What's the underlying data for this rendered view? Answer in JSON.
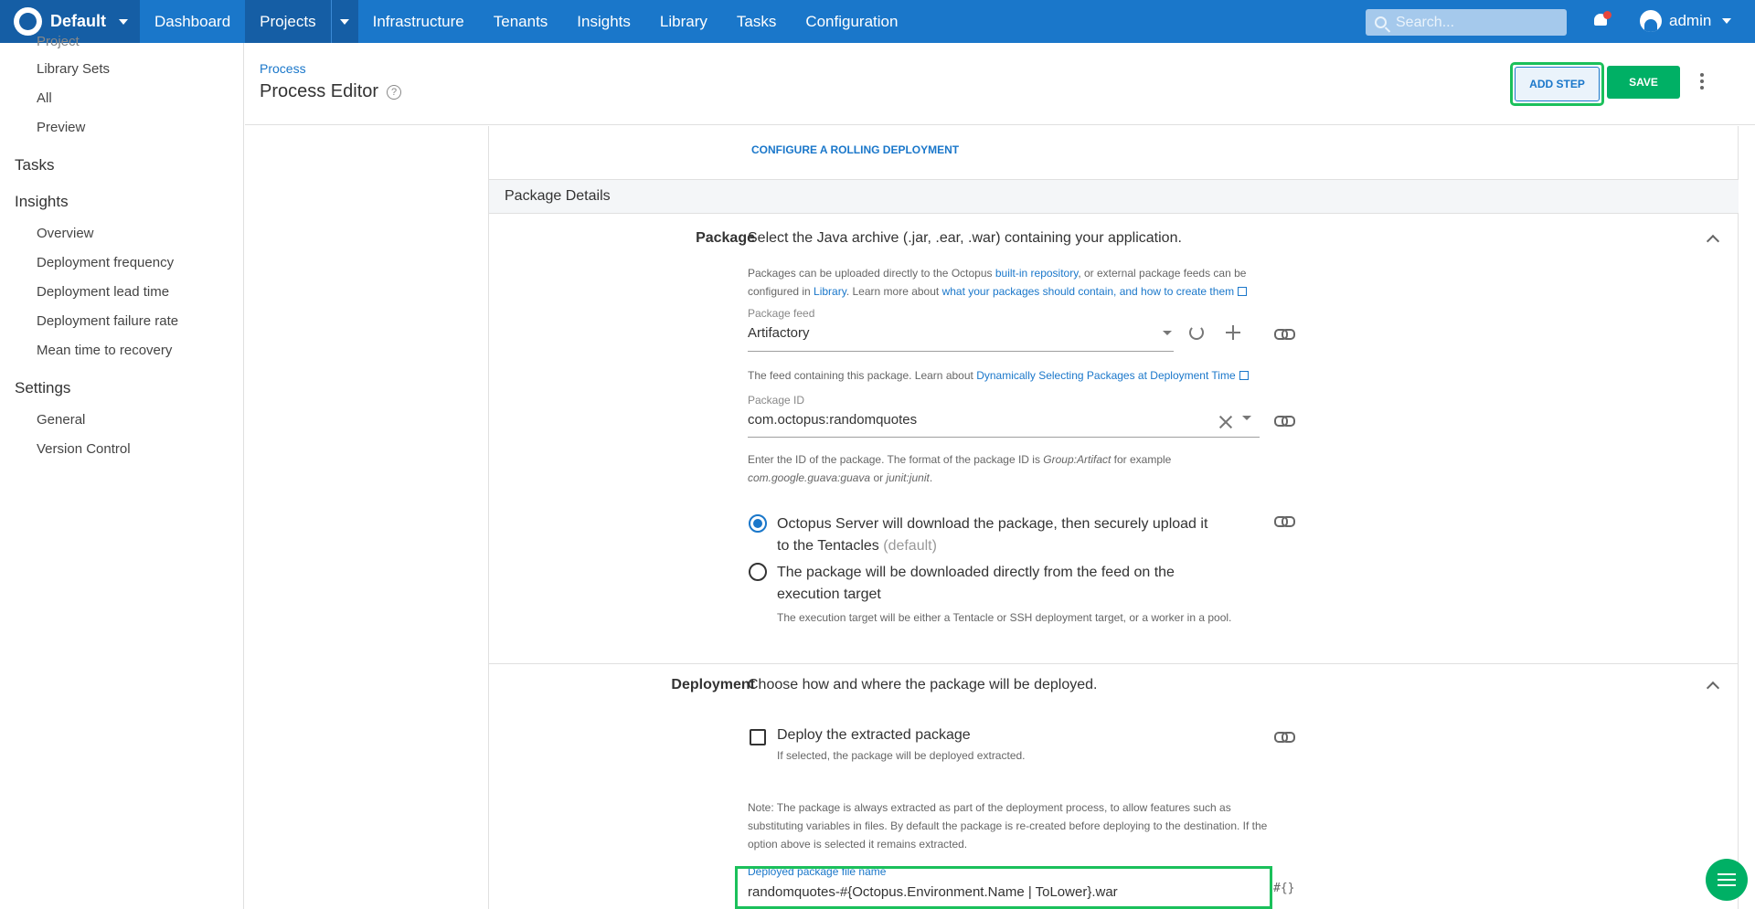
{
  "nav": {
    "space_name": "Default",
    "items": [
      "Dashboard",
      "Projects",
      "Infrastructure",
      "Tenants",
      "Insights",
      "Library",
      "Tasks",
      "Configuration"
    ],
    "search_placeholder": "Search...",
    "user": "admin"
  },
  "sidebar": {
    "cut_item": "Project",
    "library_sets": "Library Sets",
    "all": "All",
    "preview": "Preview",
    "tasks": "Tasks",
    "insights": "Insights",
    "insights_items": [
      "Overview",
      "Deployment frequency",
      "Deployment lead time",
      "Deployment failure rate",
      "Mean time to recovery"
    ],
    "settings": "Settings",
    "settings_items": [
      "General",
      "Version Control"
    ]
  },
  "header": {
    "breadcrumb": "Process",
    "title": "Process Editor",
    "help_glyph": "?",
    "add_step": "ADD STEP",
    "save": "SAVE"
  },
  "content": {
    "rolling_link": "CONFIGURE A ROLLING DEPLOYMENT",
    "section_title": "Package Details",
    "package": {
      "label": "Package",
      "summary": "Select the Java archive (.jar, .ear, .war) containing your application.",
      "help_1a": "Packages can be uploaded directly to the Octopus ",
      "help_1_link1": "built-in repository",
      "help_1b": ", or external package feeds can be",
      "help_2a": "configured in ",
      "help_2_link2": "Library",
      "help_2b": ". Learn more about ",
      "help_2_link3": "what your packages should contain, and how to create them",
      "feed_label": "Package feed",
      "feed_value": "Artifactory",
      "feed_help_a": "The feed containing this package. Learn about ",
      "feed_help_link": "Dynamically Selecting Packages at Deployment Time",
      "id_label": "Package ID",
      "id_value": "com.octopus:randomquotes",
      "id_help_1a": "Enter the ID of the package. The format of the package ID is ",
      "id_help_1_em": "Group:Artifact",
      "id_help_1b": " for example",
      "id_help_2_em1": "com.google.guava:guava",
      "id_help_2_mid": " or ",
      "id_help_2_em2": "junit:junit",
      "id_help_2_end": ".",
      "radio1_line1": "Octopus Server will download the package, then securely upload it",
      "radio1_line2": "to the Tentacles",
      "radio1_default": "(default)",
      "radio2_line1": "The package will be downloaded directly from the feed on the",
      "radio2_line2": "execution target",
      "radio2_help": "The execution target will be either a Tentacle or SSH deployment target, or a worker in a pool."
    },
    "deployment": {
      "label": "Deployment",
      "summary": "Choose how and where the package will be deployed.",
      "checkbox_label": "Deploy the extracted package",
      "checkbox_help": "If selected, the package will be deployed extracted.",
      "note_1": "Note: The package is always extracted as part of the deployment process, to allow features such as",
      "note_2": "substituting variables in files. By default the package is re-created before deploying to the destination. If the",
      "note_3": "option above is selected it remains extracted.",
      "filename_label": "Deployed package file name",
      "filename_value": "randomquotes-#{Octopus.Environment.Name | ToLower}.war",
      "var_glyph": "#{}"
    }
  }
}
